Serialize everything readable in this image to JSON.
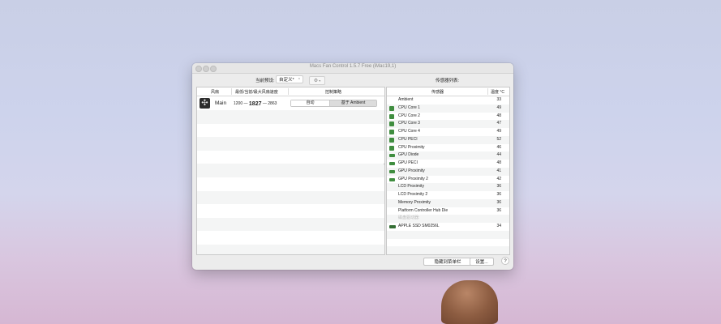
{
  "window": {
    "title": "Macs Fan Control 1.5.7 Free (iMac19,1)"
  },
  "toolbar": {
    "preset_label": "当前预设:",
    "preset_value": "自定义*",
    "sensors_list_label": "传感器列表:"
  },
  "fans_table": {
    "headers": [
      "风扇",
      "最低/当前/最大风扇速度",
      "控制策略"
    ],
    "rows": [
      {
        "name": "Main",
        "min_speed": "1200",
        "current_speed": "1827",
        "max_speed": "2863",
        "auto_label": "自动",
        "ambient_label": "基于 Ambient"
      }
    ]
  },
  "sensors_table": {
    "headers": [
      "传感器",
      "温度 °C"
    ],
    "rows": [
      {
        "name": "Ambient",
        "value": "33",
        "icon": "none"
      },
      {
        "name": "CPU Core 1",
        "value": "49",
        "icon": "cpu-icon"
      },
      {
        "name": "CPU Core 2",
        "value": "48",
        "icon": "cpu-icon"
      },
      {
        "name": "CPU Core 3",
        "value": "47",
        "icon": "cpu-icon"
      },
      {
        "name": "CPU Core 4",
        "value": "49",
        "icon": "cpu-icon"
      },
      {
        "name": "CPU PECI",
        "value": "52",
        "icon": "cpu-icon"
      },
      {
        "name": "CPU Proximity",
        "value": "46",
        "icon": "cpu-icon"
      },
      {
        "name": "GPU Diode",
        "value": "44",
        "icon": "gpu-icon"
      },
      {
        "name": "GPU PECI",
        "value": "48",
        "icon": "gpu-icon"
      },
      {
        "name": "GPU Proximity",
        "value": "41",
        "icon": "gpu-icon"
      },
      {
        "name": "GPU Proximity 2",
        "value": "42",
        "icon": "gpu-icon"
      },
      {
        "name": "LCD Proximity",
        "value": "36",
        "icon": "none"
      },
      {
        "name": "LCD Proximity 2",
        "value": "36",
        "icon": "none"
      },
      {
        "name": "Memory Proximity",
        "value": "36",
        "icon": "none"
      },
      {
        "name": "Platform Controller Hub Die",
        "value": "36",
        "icon": "none"
      },
      {
        "name": "磁盘驱动器:",
        "value": "",
        "icon": "none",
        "group": true
      },
      {
        "name": "APPLE SSD SM0256L",
        "value": "34",
        "icon": "ssd-icon"
      }
    ]
  },
  "buttons": {
    "hide_to_menu_bar": "隐藏到菜单栏",
    "settings": "设置...",
    "help": "?"
  }
}
